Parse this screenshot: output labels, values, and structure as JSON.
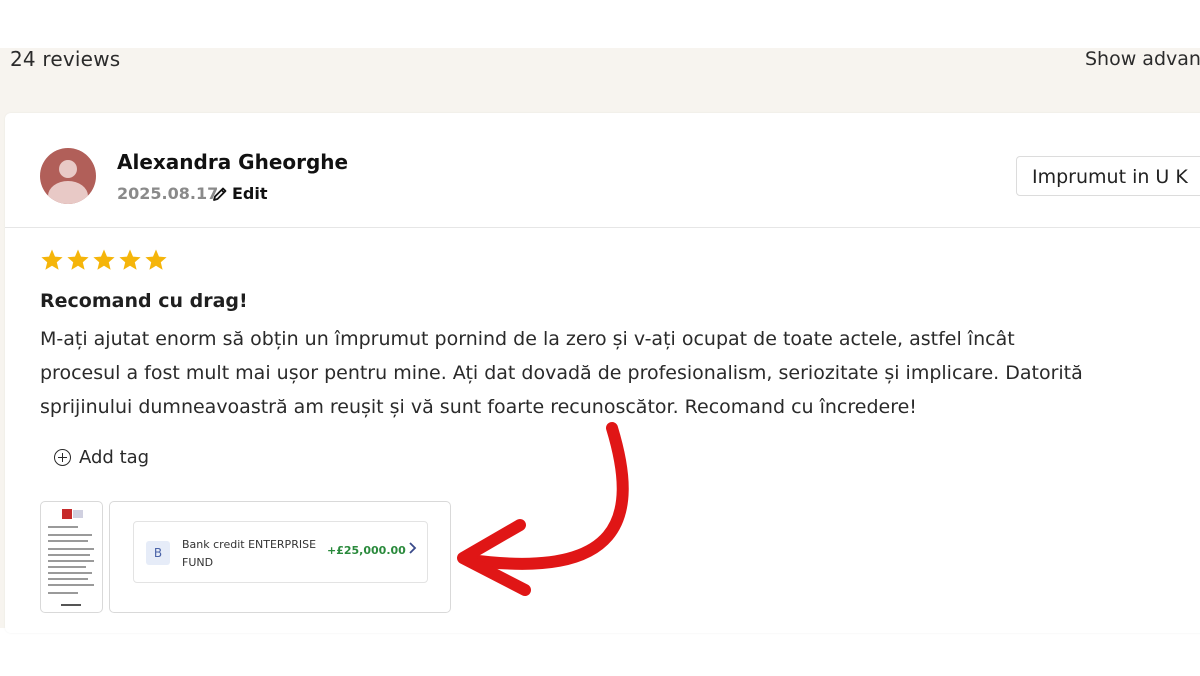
{
  "header": {
    "review_count": "24 reviews",
    "advanced_link": "Show advanced"
  },
  "review": {
    "author": "Alexandra Gheorghe",
    "date": "2025.08.17",
    "edit_label": "Edit",
    "product": "Imprumut in U K",
    "rating": 5,
    "title": "Recomand cu drag!",
    "body_lines": [
      "M-ați ajutat enorm să obțin un împrumut pornind de la zero și v-ați ocupat de toate actele, astfel încât",
      "procesul a fost mult mai ușor pentru mine. Ați dat dovadă de profesionalism, seriozitate și implicare. Datorită",
      "sprijinului dumneavoastră am reușit și vă sunt foarte recunoscător. Recomand cu încredere!"
    ],
    "add_tag_label": "Add tag"
  },
  "attachments": {
    "transaction": {
      "badge": "B",
      "name": "Bank credit ENTERPRISE FUND",
      "amount": "+£25,000.00"
    }
  },
  "colors": {
    "star": "#f5b50a",
    "avatar": "#b15f59",
    "amount": "#2a8a3c",
    "arrow": "#e01616"
  },
  "icons": {
    "edit": "pencil-icon",
    "add_tag": "plus-circle-icon",
    "transaction_chevron": "chevron-right-icon"
  }
}
